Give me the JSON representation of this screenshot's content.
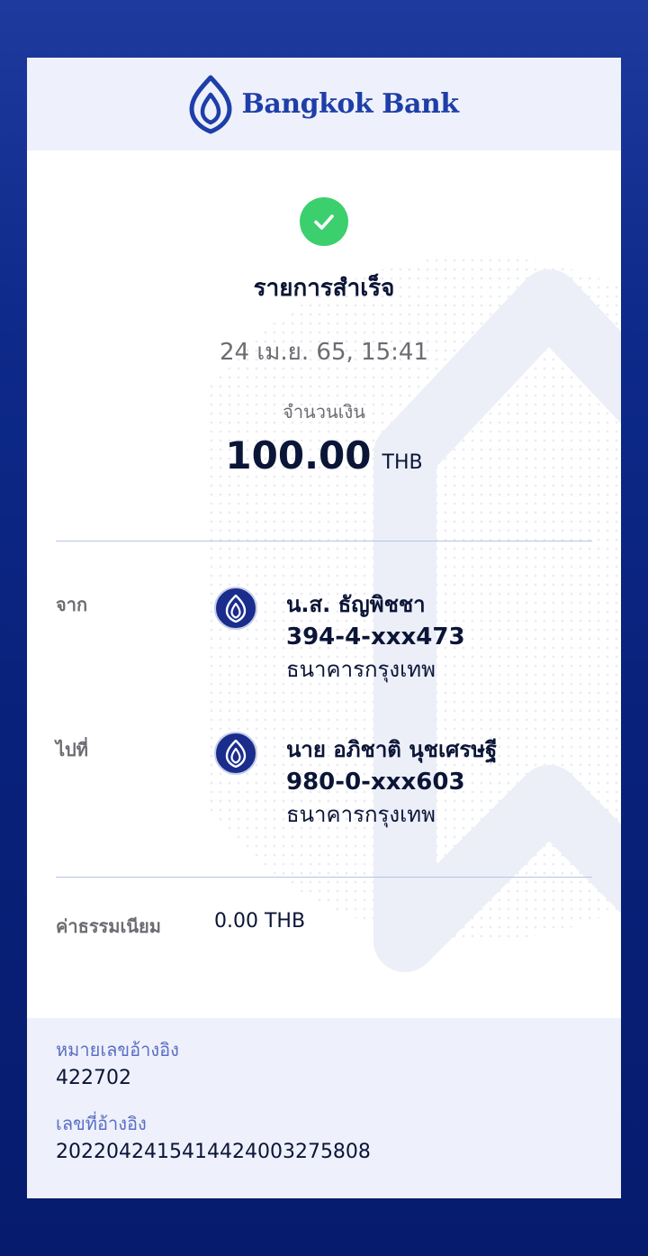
{
  "header": {
    "bank_name": "Bangkok Bank"
  },
  "status": {
    "title": "รายการสำเร็จ",
    "datetime": "24 เม.ย. 65, 15:41"
  },
  "amount": {
    "label": "จำนวนเงิน",
    "value": "100.00",
    "currency": "THB"
  },
  "from": {
    "label": "จาก",
    "name": "น.ส. ธัญพิชชา",
    "account": "394-4-xxx473",
    "bank": "ธนาคารกรุงเทพ"
  },
  "to": {
    "label": "ไปที่",
    "name": "นาย อภิชาติ นุชเศรษฐี",
    "account": "980-0-xxx603",
    "bank": "ธนาคารกรุงเทพ"
  },
  "fee": {
    "label": "ค่าธรรมเนียม",
    "value": "0.00 THB"
  },
  "reference": {
    "ref_label": "หมายเลขอ้างอิง",
    "ref_value": "422702",
    "ref2_label": "เลขที่อ้างอิง",
    "ref2_value": "2022042415414424003275808"
  },
  "colors": {
    "brand_blue": "#1e3ea8",
    "success_green": "#3ccf6e",
    "dark_text": "#0b1537"
  }
}
